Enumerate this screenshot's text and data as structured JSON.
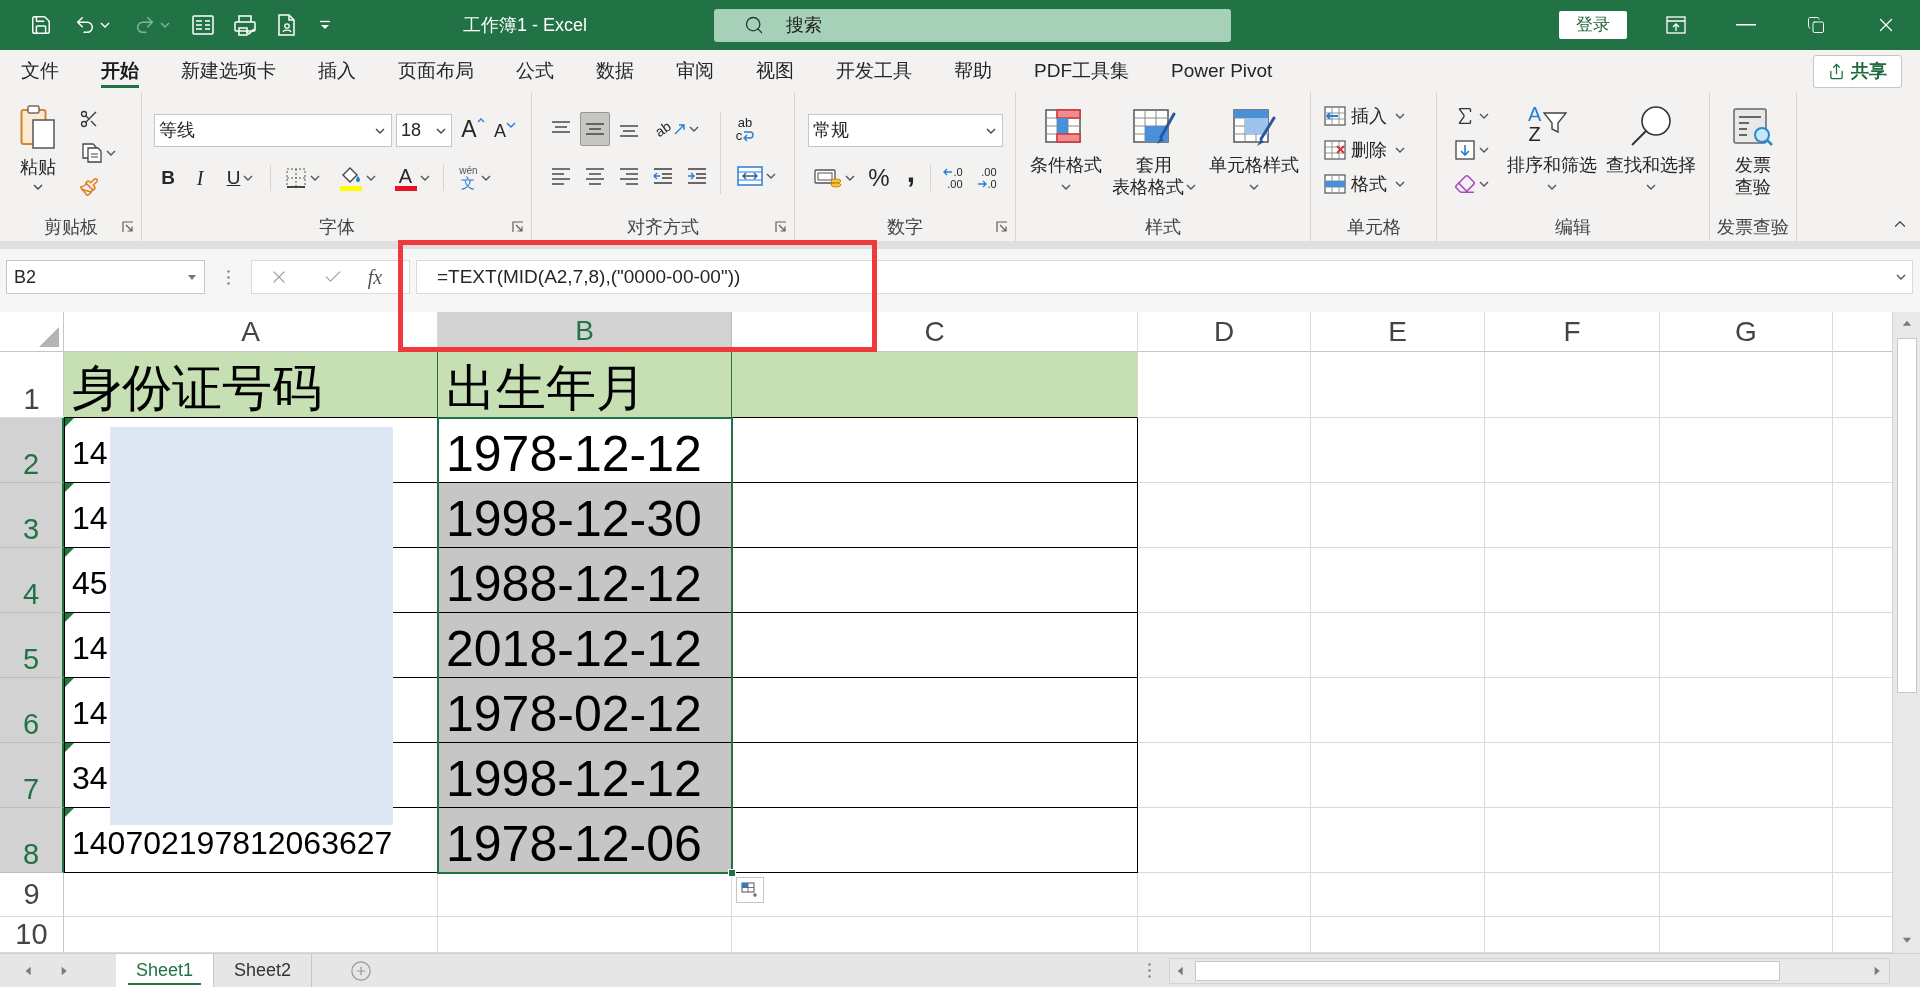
{
  "title_bar": {
    "redo": {
      "disabled": true
    },
    "title": "工作簿1 - Excel",
    "search": {
      "placeholder": "搜索"
    },
    "sign_in": "登录"
  },
  "ribbon_tabs": [
    {
      "label": "文件",
      "selected": false
    },
    {
      "label": "开始",
      "selected": true
    },
    {
      "label": "新建选项卡",
      "selected": false
    },
    {
      "label": "插入",
      "selected": false
    },
    {
      "label": "页面布局",
      "selected": false
    },
    {
      "label": "公式",
      "selected": false
    },
    {
      "label": "数据",
      "selected": false
    },
    {
      "label": "审阅",
      "selected": false
    },
    {
      "label": "视图",
      "selected": false
    },
    {
      "label": "开发工具",
      "selected": false
    },
    {
      "label": "帮助",
      "selected": false
    },
    {
      "label": "PDF工具集",
      "selected": false
    },
    {
      "label": "Power Pivot",
      "selected": false
    }
  ],
  "share_button": "共享",
  "ribbon": {
    "clipboard": {
      "paste": "粘贴",
      "label": "剪贴板"
    },
    "font": {
      "font_name": "等线",
      "font_size": "18",
      "grow": "A",
      "shrink": "A",
      "bold": "B",
      "italic": "I",
      "underline": "U",
      "font_color": "A",
      "phonetic": [
        "wén",
        "文"
      ],
      "label": "字体"
    },
    "alignment": {
      "vertical": [
        {
          "selected": false
        },
        {
          "selected": true
        },
        {
          "selected": false
        }
      ],
      "orientation": "ab",
      "horizontal": [
        {
          "selected": false
        },
        {
          "selected": false
        },
        {
          "selected": false
        }
      ],
      "wrap": [
        "ab",
        "c"
      ],
      "label": "对齐方式"
    },
    "number": {
      "format": "常规",
      "percent": "%",
      "comma": ",",
      "increase_decimal": [
        ".0",
        ".00"
      ],
      "decrease_decimal": [
        ".00",
        ".0"
      ],
      "label": "数字"
    },
    "styles": {
      "buttons": [
        [
          "条件格式"
        ],
        [
          "套用",
          "表格格式"
        ],
        [
          "单元格样式"
        ]
      ],
      "label": "样式"
    },
    "cells": {
      "buttons": [
        "插入",
        "删除",
        "格式"
      ],
      "label": "单元格"
    },
    "editing": {
      "sort_glyphs": [
        "A",
        "Z"
      ],
      "sort": "排序和筛选",
      "find": "查找和选择",
      "label": "编辑"
    },
    "invoice": {
      "button": [
        "发票",
        "查验"
      ],
      "label": "发票查验"
    }
  },
  "formula_bar": {
    "name_box": "B2",
    "fx": "fx",
    "formula": "=TEXT(MID(A2,7,8),(\"0000-00-00\"))"
  },
  "sheet": {
    "columns": [
      {
        "label": "A",
        "selected": false
      },
      {
        "label": "B",
        "selected": true
      },
      {
        "label": "C",
        "selected": false
      },
      {
        "label": "D",
        "selected": false
      },
      {
        "label": "E",
        "selected": false
      },
      {
        "label": "F",
        "selected": false
      },
      {
        "label": "G",
        "selected": false
      }
    ],
    "rows": [
      {
        "label": "1",
        "kind": "header",
        "selected": false,
        "cells": [
          {
            "text": "身份证号码",
            "selected": false,
            "active": false,
            "flagged": false
          },
          {
            "text": "出生年月",
            "selected": false,
            "active": false,
            "flagged": false
          }
        ]
      },
      {
        "label": "2",
        "kind": "data",
        "selected": true,
        "cells": [
          {
            "text": "14",
            "selected": false,
            "active": false,
            "flagged": true
          },
          {
            "text": "1978-12-12",
            "selected": true,
            "active": true,
            "flagged": false
          }
        ]
      },
      {
        "label": "3",
        "kind": "data",
        "selected": true,
        "cells": [
          {
            "text": "14",
            "selected": false,
            "active": false,
            "flagged": true
          },
          {
            "text": "1998-12-30",
            "selected": true,
            "active": false,
            "flagged": false
          }
        ]
      },
      {
        "label": "4",
        "kind": "data",
        "selected": true,
        "cells": [
          {
            "text": "45",
            "selected": false,
            "active": false,
            "flagged": true
          },
          {
            "text": "1988-12-12",
            "selected": true,
            "active": false,
            "flagged": false
          }
        ]
      },
      {
        "label": "5",
        "kind": "data",
        "selected": true,
        "cells": [
          {
            "text": "14",
            "selected": false,
            "active": false,
            "flagged": true
          },
          {
            "text": "2018-12-12",
            "selected": true,
            "active": false,
            "flagged": false
          }
        ]
      },
      {
        "label": "6",
        "kind": "data",
        "selected": true,
        "cells": [
          {
            "text": "14",
            "selected": false,
            "active": false,
            "flagged": true
          },
          {
            "text": "1978-02-12",
            "selected": true,
            "active": false,
            "flagged": false
          }
        ]
      },
      {
        "label": "7",
        "kind": "data",
        "selected": true,
        "cells": [
          {
            "text": "34",
            "selected": false,
            "active": false,
            "flagged": true
          },
          {
            "text": "1998-12-12",
            "selected": true,
            "active": false,
            "flagged": false
          }
        ]
      },
      {
        "label": "8",
        "kind": "data",
        "selected": true,
        "cells": [
          {
            "text": "140702197812063627",
            "selected": false,
            "active": false,
            "flagged": true
          },
          {
            "text": "1978-12-06",
            "selected": true,
            "active": false,
            "flagged": false
          }
        ]
      },
      {
        "label": "9",
        "kind": "empty",
        "selected": false
      },
      {
        "label": "10",
        "kind": "empty",
        "selected": false
      }
    ]
  },
  "sheet_tabs": [
    {
      "label": "Sheet1",
      "selected": true
    },
    {
      "label": "Sheet2",
      "selected": false
    }
  ]
}
